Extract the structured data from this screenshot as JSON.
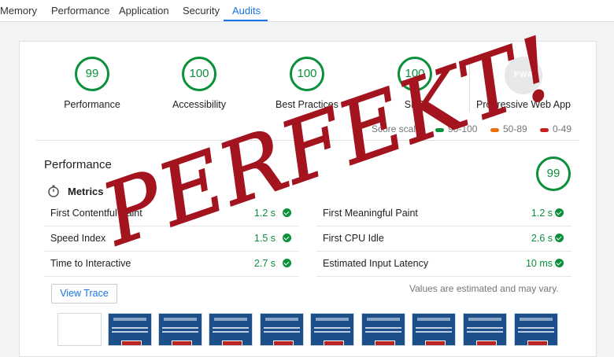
{
  "tabs": [
    "Memory",
    "Performance",
    "Application",
    "Security",
    "Audits"
  ],
  "active_tab": "Audits",
  "categories": [
    {
      "label": "Performance",
      "score": "99"
    },
    {
      "label": "Accessibility",
      "score": "100"
    },
    {
      "label": "Best Practices",
      "score": "100"
    },
    {
      "label": "SEO",
      "score": "100"
    }
  ],
  "pwa": {
    "badge": "PWA",
    "label": "Progressive Web App"
  },
  "score_scale": {
    "label": "Score scale:",
    "ranges": [
      {
        "label": "90-100",
        "color": "#0a8f3a"
      },
      {
        "label": "50-89",
        "color": "#e8710a"
      },
      {
        "label": "0-49",
        "color": "#c5221f"
      }
    ]
  },
  "performance": {
    "title": "Performance",
    "score": "99",
    "metrics_title": "Metrics",
    "metrics_left": [
      {
        "label": "First Contentful Paint",
        "value": "1.2 s"
      },
      {
        "label": "Speed Index",
        "value": "1.5 s"
      },
      {
        "label": "Time to Interactive",
        "value": "2.7 s"
      }
    ],
    "metrics_right": [
      {
        "label": "First Meaningful Paint",
        "value": "1.2 s"
      },
      {
        "label": "First CPU Idle",
        "value": "2.6 s"
      },
      {
        "label": "Estimated Input Latency",
        "value": "10 ms"
      }
    ],
    "view_trace": "View Trace",
    "note": "Values are estimated and may vary."
  },
  "overlay_text": "PERFEKT!",
  "colors": {
    "pass": "#0a8f3a",
    "accent": "#1a73e8",
    "overlay": "#a3141f"
  }
}
